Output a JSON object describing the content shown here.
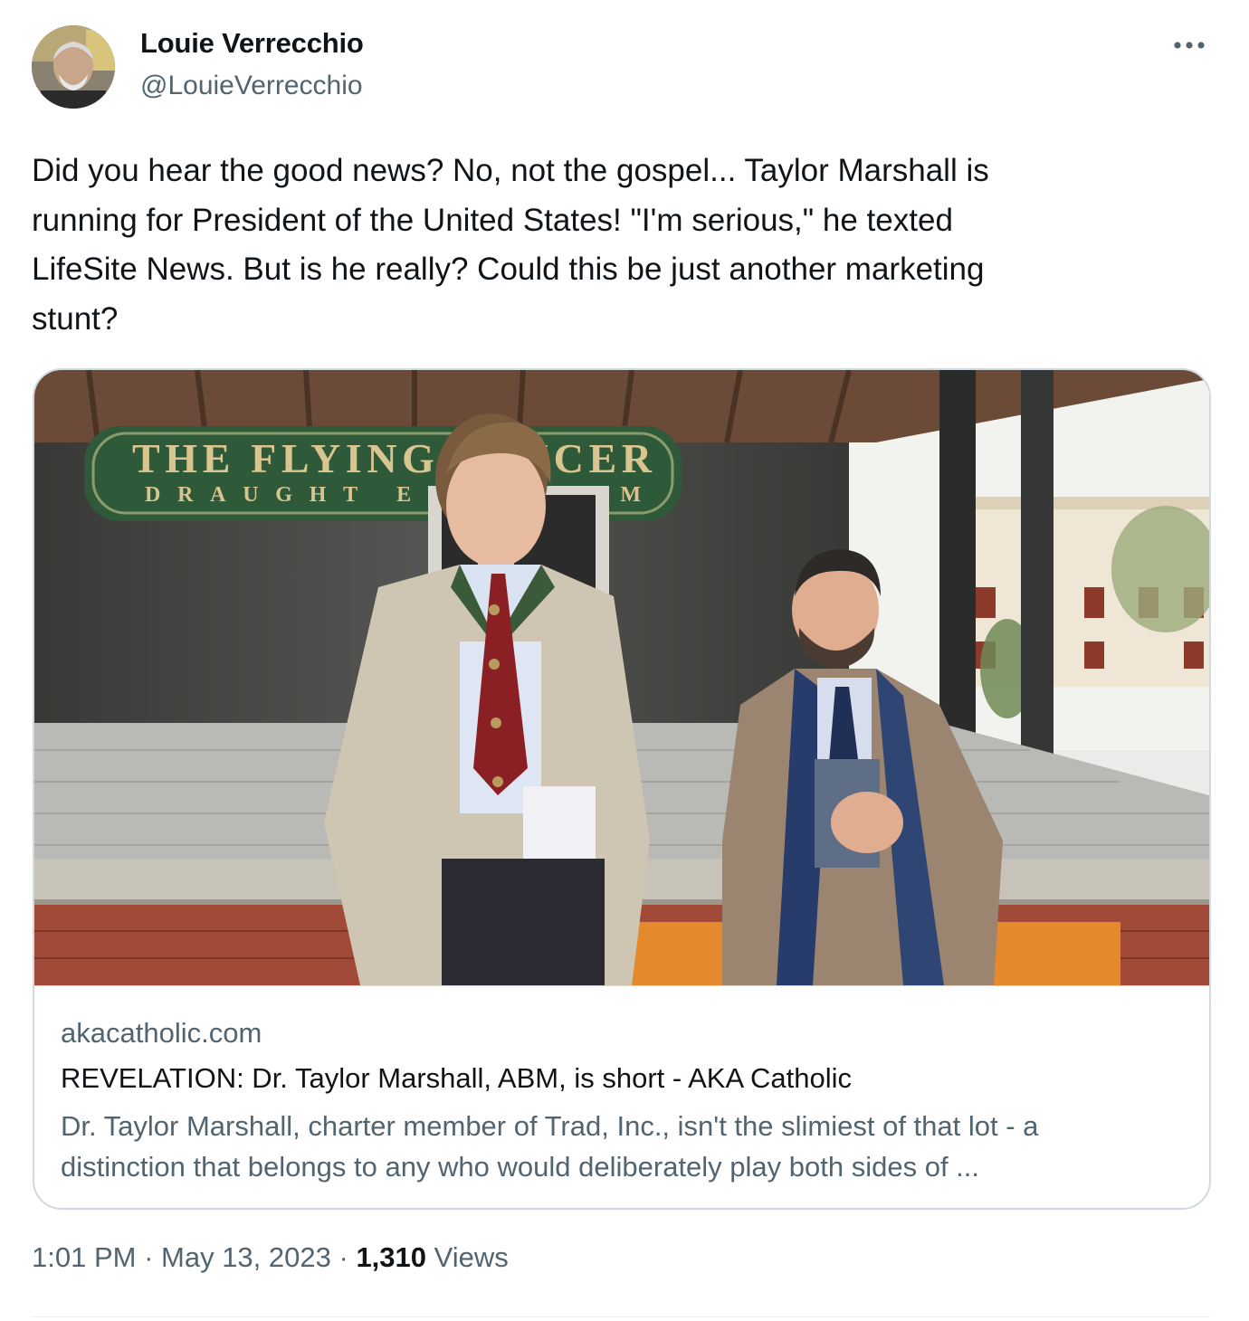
{
  "author": {
    "name": "Louie Verrecchio",
    "handle": "@LouieVerrecchio"
  },
  "tweet": {
    "text": "Did you hear the good news? No, not the gospel... Taylor Marshall is\nrunning for President of the United States! \"I'm serious,\" he texted\nLifeSite News. But is he really? Could this be just another marketing\nstunt?"
  },
  "card": {
    "domain": "akacatholic.com",
    "title": "REVELATION: Dr. Taylor Marshall, ABM, is short - AKA Catholic",
    "description": "Dr. Taylor Marshall, charter member of Trad, Inc., isn't the slimiest of that lot - a\ndistinction that belongs to any who would deliberately play both sides of ...",
    "image_sign_text": "THE FLYING SAUCER",
    "image_sign_subtext": "DRAUGHT EMPORIUM"
  },
  "footer": {
    "time": "1:01 PM",
    "separator": " · ",
    "date": "May 13, 2023",
    "views_count": "1,310",
    "views_label": " Views"
  },
  "icons": {
    "more": "more-horizontal-icon"
  },
  "colors": {
    "text_primary": "#0f1419",
    "text_secondary": "#536471",
    "border": "#cfd9de"
  }
}
